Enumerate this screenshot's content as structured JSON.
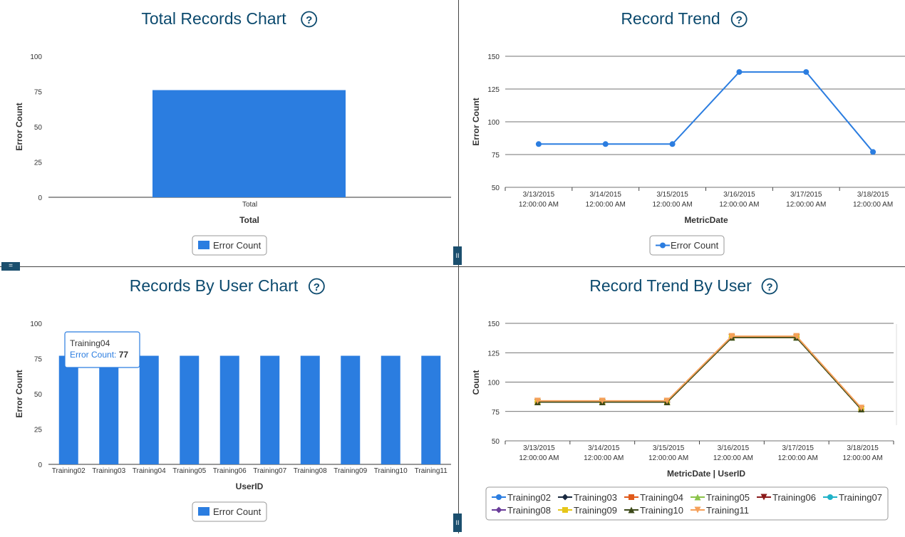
{
  "handles": {
    "horizontal": "=",
    "vertical": "II"
  },
  "help_glyph": "?",
  "colors": {
    "title": "#0c4a6e",
    "bar": "#2b7de0",
    "line": "#2b7de0"
  },
  "tooltip": {
    "name": "Training04",
    "label": "Error Count",
    "value": "77"
  },
  "chart_data": [
    {
      "type": "bar",
      "title": "Total Records Chart",
      "xlabel": "Total",
      "ylabel": "Error Count",
      "categories": [
        "Total"
      ],
      "ylim": [
        0,
        100
      ],
      "yticks": [
        0,
        25,
        50,
        75,
        100
      ],
      "series": [
        {
          "name": "Error Count",
          "values": [
            76
          ]
        }
      ],
      "legend": "bottom-center"
    },
    {
      "type": "line",
      "title": "Record Trend",
      "xlabel": "MetricDate",
      "ylabel": "Error Count",
      "categories": [
        [
          "3/13/2015",
          "12:00:00 AM"
        ],
        [
          "3/14/2015",
          "12:00:00 AM"
        ],
        [
          "3/15/2015",
          "12:00:00 AM"
        ],
        [
          "3/16/2015",
          "12:00:00 AM"
        ],
        [
          "3/17/2015",
          "12:00:00 AM"
        ],
        [
          "3/18/2015",
          "12:00:00 AM"
        ]
      ],
      "ylim": [
        50,
        150
      ],
      "yticks": [
        50,
        75,
        100,
        125,
        150
      ],
      "grid": true,
      "series": [
        {
          "name": "Error Count",
          "values": [
            83,
            83,
            83,
            138,
            138,
            77
          ]
        }
      ],
      "legend": "bottom-center"
    },
    {
      "type": "bar",
      "title": "Records By User Chart",
      "xlabel": "UserID",
      "ylabel": "Error Count",
      "categories": [
        "Training02",
        "Training03",
        "Training04",
        "Training05",
        "Training06",
        "Training07",
        "Training08",
        "Training09",
        "Training10",
        "Training11"
      ],
      "ylim": [
        0,
        100
      ],
      "yticks": [
        0,
        25,
        50,
        75,
        100
      ],
      "series": [
        {
          "name": "Error Count",
          "values": [
            77,
            77,
            77,
            77,
            77,
            77,
            77,
            77,
            77,
            77
          ]
        }
      ],
      "legend": "bottom-center"
    },
    {
      "type": "line",
      "title": "Record Trend By User",
      "xlabel": "MetricDate | UserID",
      "ylabel": "Count",
      "categories": [
        [
          "3/13/2015",
          "12:00:00 AM"
        ],
        [
          "3/14/2015",
          "12:00:00 AM"
        ],
        [
          "3/15/2015",
          "12:00:00 AM"
        ],
        [
          "3/16/2015",
          "12:00:00 AM"
        ],
        [
          "3/17/2015",
          "12:00:00 AM"
        ],
        [
          "3/18/2015",
          "12:00:00 AM"
        ]
      ],
      "ylim": [
        50,
        150
      ],
      "yticks": [
        50,
        75,
        100,
        125,
        150
      ],
      "grid": true,
      "series": [
        {
          "name": "Training02",
          "color": "#2b7de0",
          "marker": "circle",
          "values": [
            83,
            83,
            83,
            138,
            138,
            77
          ]
        },
        {
          "name": "Training03",
          "color": "#1a2a40",
          "marker": "diamond",
          "values": [
            83,
            83,
            83,
            138,
            138,
            77
          ]
        },
        {
          "name": "Training04",
          "color": "#e05a1a",
          "marker": "square",
          "values": [
            83,
            83,
            83,
            138,
            138,
            77
          ]
        },
        {
          "name": "Training05",
          "color": "#8bc34a",
          "marker": "triangle",
          "values": [
            83,
            83,
            83,
            138,
            138,
            77
          ]
        },
        {
          "name": "Training06",
          "color": "#8b1a1a",
          "marker": "triangle-down",
          "values": [
            83,
            83,
            83,
            138,
            138,
            77
          ]
        },
        {
          "name": "Training07",
          "color": "#20b2c8",
          "marker": "circle",
          "values": [
            83,
            83,
            83,
            138,
            138,
            77
          ]
        },
        {
          "name": "Training08",
          "color": "#6a3d9a",
          "marker": "diamond",
          "values": [
            83,
            83,
            83,
            138,
            138,
            77
          ]
        },
        {
          "name": "Training09",
          "color": "#e6c619",
          "marker": "square",
          "values": [
            83,
            83,
            83,
            138,
            138,
            77
          ]
        },
        {
          "name": "Training10",
          "color": "#3d4a1a",
          "marker": "triangle",
          "values": [
            83,
            83,
            83,
            138,
            138,
            77
          ]
        },
        {
          "name": "Training11",
          "color": "#f5a05a",
          "marker": "triangle-down",
          "values": [
            84,
            84,
            84,
            139,
            139,
            78
          ]
        }
      ],
      "legend": "bottom-center"
    }
  ]
}
